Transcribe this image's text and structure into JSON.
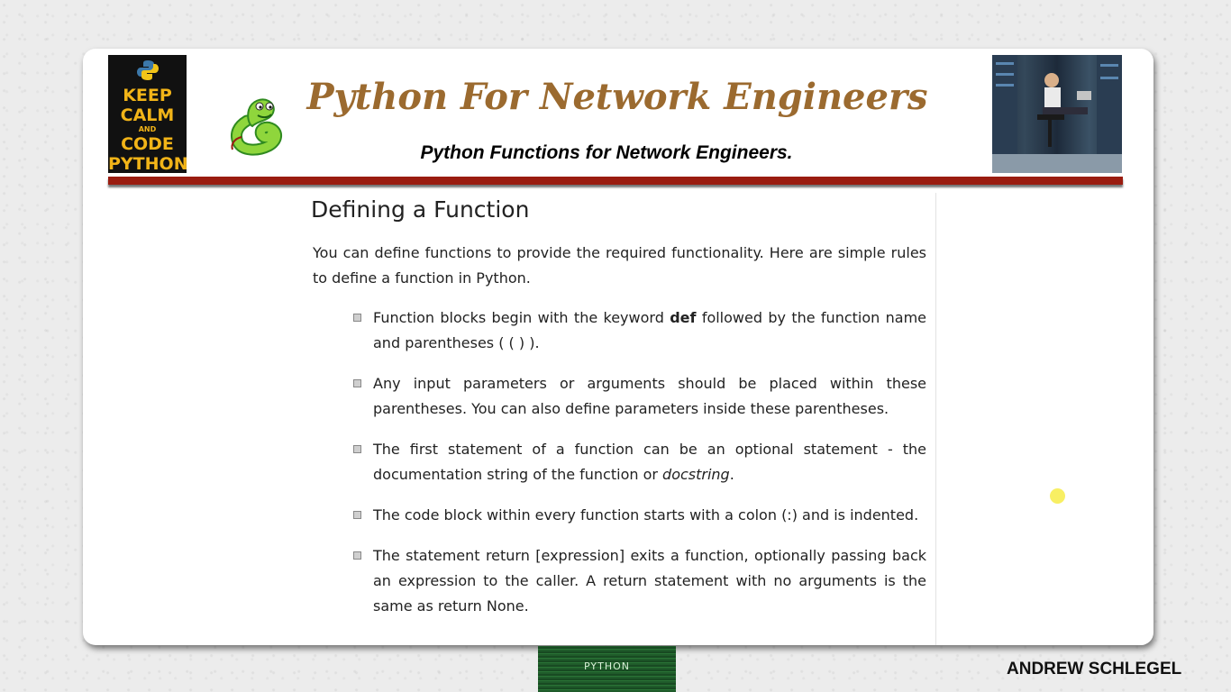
{
  "header": {
    "logo": {
      "lines": [
        "KEEP",
        "CALM",
        "AND",
        "CODE",
        "PYTHON"
      ],
      "icon": "python-logo-icon"
    },
    "mascot_icon": "green-snake-mascot-icon",
    "title": "Python For Network Engineers",
    "subtitle": "Python Functions for Network Engineers.",
    "photo": "network-engineer-datacenter-photo"
  },
  "content": {
    "heading": "Defining a Function",
    "intro": "You can define functions to provide the required functionality. Here are simple rules to define a function in Python.",
    "rules": [
      {
        "before": "Function blocks begin with the keyword ",
        "strong": "def",
        "after": " followed by the function name and parentheses ( ( ) )."
      },
      {
        "text": "Any input parameters or arguments should be placed within these parentheses. You can also define parameters inside these parentheses."
      },
      {
        "before": "The first statement of a function can be an optional statement - the documentation string of the function or ",
        "em": "docstring",
        "after": "."
      },
      {
        "text": "The code block within every function starts with a colon (:) and is indented."
      },
      {
        "text": "The statement return [expression] exits a function, optionally passing back an expression to the caller. A return statement with no arguments is the same as return None."
      }
    ]
  },
  "footer": {
    "thumbnail_label": "PYTHON",
    "author": "ANDREW SCHLEGEL"
  },
  "colors": {
    "title": "#9b6a2f",
    "divider": "#9a1c10",
    "logo_background": "#111111",
    "logo_text": "#f2b418",
    "pointer": "#f7ec48"
  }
}
